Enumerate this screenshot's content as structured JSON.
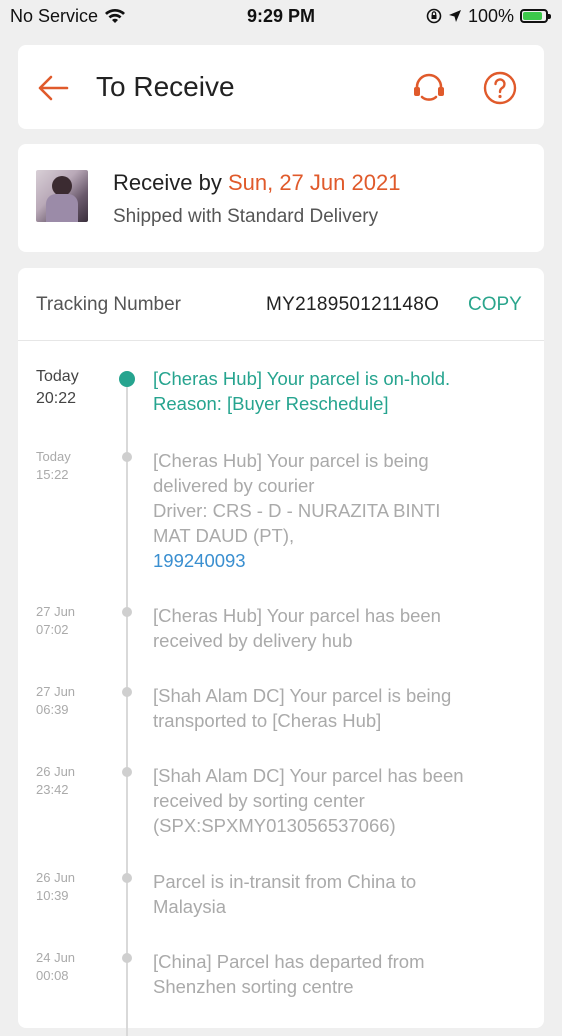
{
  "status_bar": {
    "carrier": "No Service",
    "time": "9:29 PM",
    "battery": "100%"
  },
  "header": {
    "title": "To Receive",
    "back_icon": "arrow-left-icon",
    "support_icon": "headset-icon",
    "help_icon": "question-circle-icon",
    "accent_color": "#e05a2b"
  },
  "receive": {
    "prefix": "Receive by ",
    "date": "Sun, 27 Jun 2021",
    "shipped": "Shipped with Standard Delivery"
  },
  "tracking": {
    "label": "Tracking Number",
    "number": "MY218950121148O",
    "copy": "COPY",
    "accent_color": "#26a48f"
  },
  "events": [
    {
      "date": "Today",
      "time": "20:22",
      "current": true,
      "lines": [
        "[Cheras Hub] Your parcel is on-hold.",
        "Reason: [Buyer Reschedule]"
      ]
    },
    {
      "date": "Today",
      "time": "15:22",
      "current": false,
      "lines": [
        "[Cheras Hub] Your parcel is being",
        "delivered by courier",
        "Driver: CRS - D - NURAZITA BINTI",
        "MAT DAUD (PT),"
      ],
      "phone": "199240093"
    },
    {
      "date": "27 Jun",
      "time": "07:02",
      "current": false,
      "lines": [
        "[Cheras Hub] Your parcel has been",
        "received by delivery hub"
      ]
    },
    {
      "date": "27 Jun",
      "time": "06:39",
      "current": false,
      "lines": [
        "[Shah Alam DC] Your parcel is being",
        "transported to [Cheras Hub]"
      ]
    },
    {
      "date": "26 Jun",
      "time": "23:42",
      "current": false,
      "lines": [
        "[Shah Alam DC] Your parcel has been",
        "received by sorting center",
        "(SPX:SPXMY013056537066)"
      ]
    },
    {
      "date": "26 Jun",
      "time": "10:39",
      "current": false,
      "lines": [
        "Parcel is in-transit from China to",
        "Malaysia"
      ]
    },
    {
      "date": "24 Jun",
      "time": "00:08",
      "current": false,
      "lines": [
        "[China] Parcel has departed from",
        "Shenzhen sorting centre"
      ]
    }
  ]
}
